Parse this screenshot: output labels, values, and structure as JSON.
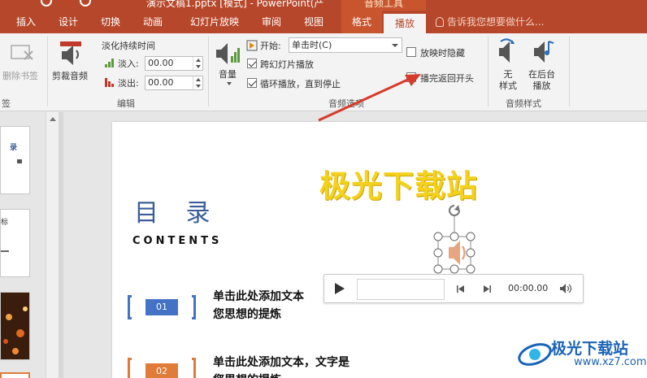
{
  "title_bar": {
    "file_title": "演示文稿1.pptx [模式] - PowerPoint(产",
    "context_tab": "音频工具"
  },
  "tabs": [
    {
      "label": "插入"
    },
    {
      "label": "设计"
    },
    {
      "label": "切换"
    },
    {
      "label": "动画"
    },
    {
      "label": "幻灯片放映"
    },
    {
      "label": "审阅"
    },
    {
      "label": "视图"
    },
    {
      "label": "格式"
    },
    {
      "label": "播放"
    }
  ],
  "tell_me": "告诉我您想要做什么...",
  "ribbon": {
    "bookmarks": {
      "remove_label": "删除书签",
      "group_label": "签"
    },
    "editing": {
      "trim_label": "剪裁音频",
      "fade_title": "淡化持续时间",
      "fade_in_label": "淡入:",
      "fade_in_value": "00.00",
      "fade_out_label": "淡出:",
      "fade_out_value": "00.00",
      "group_label": "编辑"
    },
    "audio_options": {
      "volume_label": "音量",
      "start_label": "开始:",
      "start_value": "单击时(C)",
      "cross_slides": "跨幻灯片播放",
      "loop": "循环播放，直到停止",
      "hide_during_show": "放映时隐藏",
      "rewind": "播完返回开头",
      "group_label": "音频选项"
    },
    "audio_styles": {
      "no_style": "无\n样式",
      "play_background": "在后台\n播放",
      "group_label": "音频样式"
    }
  },
  "slide": {
    "logo_title": "极光下载站",
    "heading": "目 录",
    "subheading": "CONTENTS",
    "items": [
      {
        "num": "01",
        "line1": "单击此处添加文本",
        "line2": "您思想的提炼"
      },
      {
        "num": "02",
        "line1": "单击此处添加文本，文字是",
        "line2": "您思想的提炼"
      }
    ]
  },
  "player": {
    "time": "00:00.00"
  },
  "watermark": {
    "name": "极光下载站",
    "url": "www.xz7.com"
  },
  "thumb_partial": {
    "t1": "录",
    "t2": "标"
  },
  "colors": {
    "accent": "#b7472a",
    "blue_num": "#4472c4",
    "orange_num": "#e07b39",
    "arrow": "#d63a2a"
  }
}
